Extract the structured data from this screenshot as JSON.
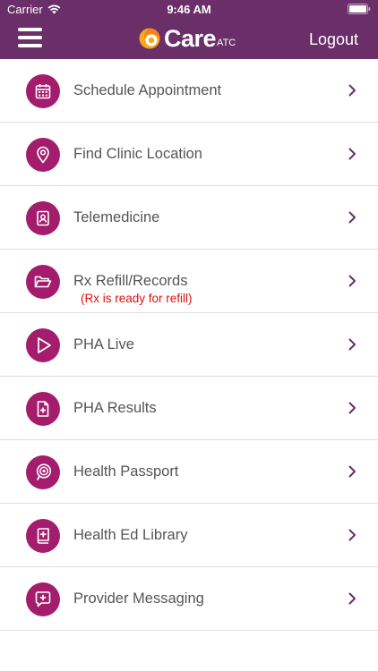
{
  "status_bar": {
    "carrier": "Carrier",
    "time": "9:46 AM"
  },
  "header": {
    "logo_text": "Care",
    "logo_sub": "ATC",
    "logout_label": "Logout"
  },
  "menu": {
    "items": [
      {
        "label": "Schedule Appointment",
        "icon": "calendar-icon"
      },
      {
        "label": "Find Clinic Location",
        "icon": "location-pin-icon"
      },
      {
        "label": "Telemedicine",
        "icon": "id-badge-icon"
      },
      {
        "label": "Rx Refill/Records",
        "note": "(Rx is ready for refill)",
        "icon": "folder-icon"
      },
      {
        "label": "PHA Live",
        "icon": "play-icon"
      },
      {
        "label": "PHA Results",
        "icon": "document-plus-icon"
      },
      {
        "label": "Health Passport",
        "icon": "target-pin-icon"
      },
      {
        "label": "Health Ed Library",
        "icon": "book-plus-icon"
      },
      {
        "label": "Provider Messaging",
        "icon": "chat-plus-icon"
      }
    ]
  },
  "colors": {
    "header_bg": "#6a2f68",
    "icon_bg": "#a41d6d",
    "chevron": "#6a2f68",
    "alert_text": "#e00e0e"
  }
}
